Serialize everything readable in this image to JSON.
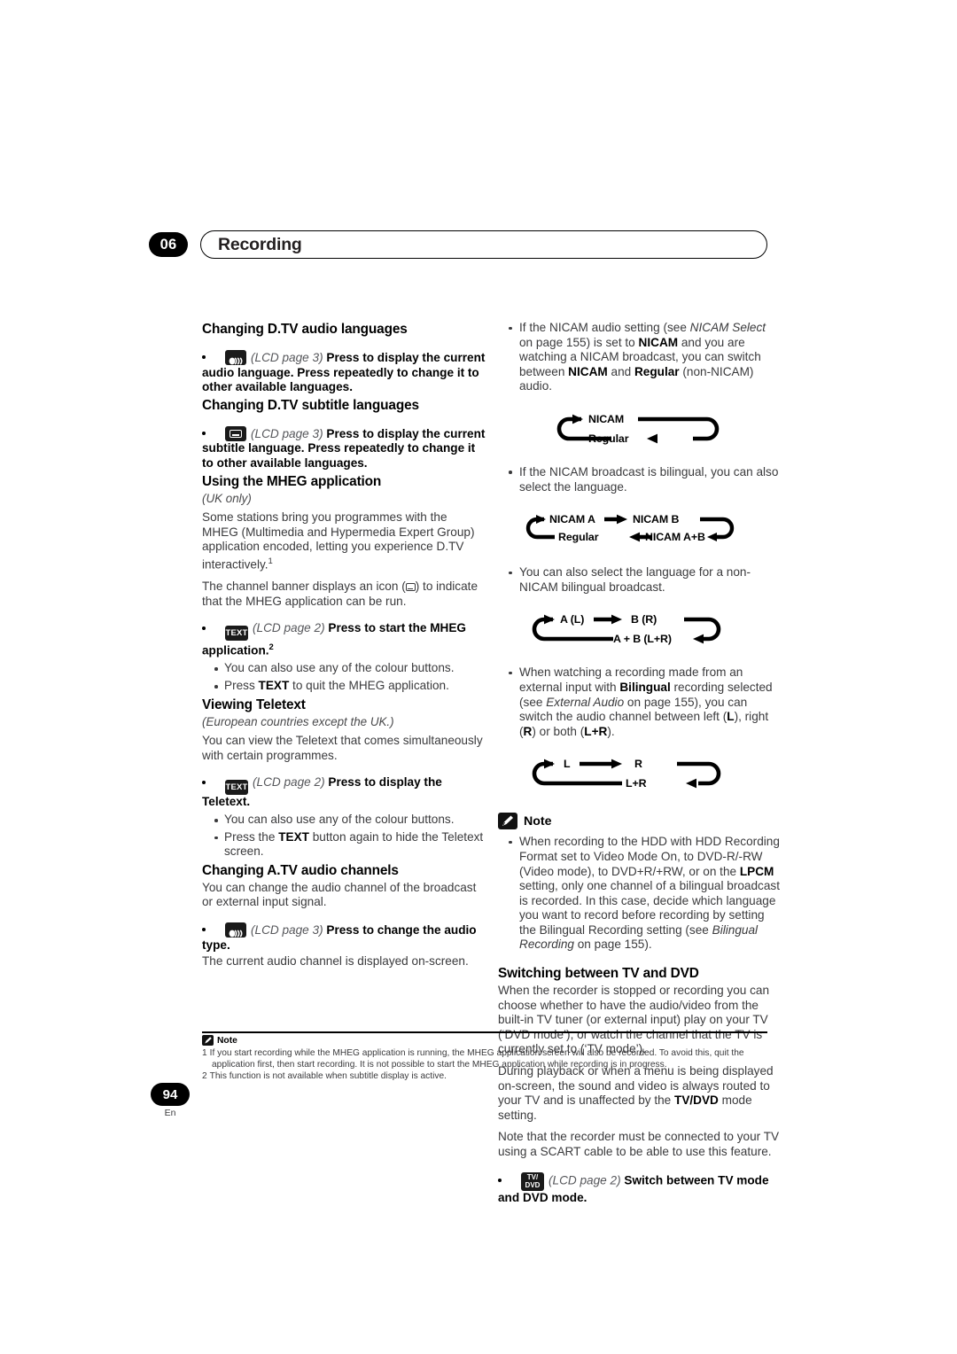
{
  "header": {
    "chapter_number": "06",
    "chapter_title": "Recording"
  },
  "left_column": {
    "s1": {
      "heading": "Changing D.TV audio languages",
      "key_icon": "audio-button-icon",
      "lcd": "(LCD page 3)",
      "instruction": "Press to display the current audio language. Press repeatedly to change it to other available languages."
    },
    "s2": {
      "heading": "Changing D.TV subtitle languages",
      "key_icon": "subtitle-button-icon",
      "lcd": "(LCD page 3)",
      "instruction": "Press to display the current subtitle language. Press repeatedly to change it to other available languages."
    },
    "s3": {
      "heading": "Using the MHEG application",
      "region": "(UK only)",
      "para1_a": "Some stations bring you programmes with the MHEG (Multimedia and Hypermedia Expert Group) application encoded, letting you experience D.TV interactively.",
      "para1_sup": "1",
      "para2_a": "The channel banner displays an icon (",
      "para2_b": ") to indicate that the MHEG application can be run.",
      "key_icon": "text-button-icon",
      "key_label": "TEXT",
      "lcd": "(LCD page 2)",
      "instruction": "Press to start the MHEG application.",
      "instruction_sup": "2",
      "sub_bullets": [
        "You can also use any of the colour buttons.",
        "Press TEXT to quit the MHEG application."
      ]
    },
    "s4": {
      "heading": "Viewing Teletext",
      "region": "(European countries except the UK.)",
      "para1": "You can view the Teletext that comes simultaneously with certain programmes.",
      "key_icon": "text-button-icon",
      "key_label": "TEXT",
      "lcd": "(LCD page 2)",
      "instruction": "Press to display the Teletext.",
      "sub_bullets": [
        "You can also use any of the colour buttons.",
        "Press the TEXT button again to hide the Teletext screen."
      ]
    },
    "s5": {
      "heading": "Changing A.TV audio channels",
      "para1": "You can change the audio channel of the broadcast or external input signal.",
      "key_icon": "audio-button-icon",
      "lcd": "(LCD page 3)",
      "instruction": "Press to change the audio type.",
      "para2": "The current audio channel is displayed on-screen."
    }
  },
  "right_column": {
    "bullets": [
      "If the NICAM audio setting (see NICAM Select on page 155) is set to NICAM and you are watching a NICAM broadcast, you can switch between NICAM and Regular (non-NICAM) audio.",
      "If the NICAM broadcast is bilingual, you can also select the language.",
      "You can also select the language for a non-NICAM bilingual broadcast.",
      "When watching a recording made from an external input with Bilingual recording selected (see External Audio on page 155), you can switch the audio channel between left (L), right (R) or both (L+R)."
    ],
    "diagrams": [
      {
        "name": "nicam-regular-cycle",
        "labels": [
          "NICAM",
          "Regular"
        ]
      },
      {
        "name": "nicam-bilingual-cycle",
        "labels": [
          "NICAM A",
          "NICAM B",
          "NICAM A+B",
          "Regular"
        ]
      },
      {
        "name": "non-nicam-bilingual-cycle",
        "labels": [
          "A (L)",
          "B (R)",
          "A + B (L+R)"
        ]
      },
      {
        "name": "external-lr-cycle",
        "labels": [
          "L",
          "R",
          "L+R"
        ]
      }
    ],
    "note": {
      "label": "Note",
      "text": "When recording to the HDD with HDD Recording Format set to Video Mode On, to DVD-R/-RW (Video mode), to DVD+R/+RW, or on the LPCM setting, only one channel of a bilingual broadcast is recorded. In this case, decide which language you want to record before recording by setting the Bilingual Recording setting (see Bilingual Recording on page 155)."
    },
    "s6": {
      "heading": "Switching between TV and DVD",
      "para1": "When the recorder is stopped or recording you can choose whether to have the audio/video from the built-in TV tuner (or external input) play on your TV (‘DVD mode’), or watch the channel that the TV is currently set to (‘TV mode’).",
      "para2": "During playback or when a menu is being displayed on-screen, the sound and video is always routed to your TV and is unaffected by the TV/DVD mode setting.",
      "para3": "Note that the recorder must be connected to your TV using a SCART cable to be able to use this feature.",
      "key_icon": "tv-dvd-button-icon",
      "key_label_line1": "TV/",
      "key_label_line2": "DVD",
      "lcd": "(LCD page 2)",
      "instruction": "Switch between TV mode and DVD mode."
    }
  },
  "footnotes": {
    "label": "Note",
    "items": [
      {
        "num": "1",
        "text": "If you start recording while the MHEG application is running, the MHEG application screen will also be recorded. To avoid this, quit the application first, then start recording. It is not possible to start the MHEG application while recording is in progress."
      },
      {
        "num": "2",
        "text": "This function is not available when subtitle display is active."
      }
    ]
  },
  "footer": {
    "page_number": "94",
    "language": "En"
  }
}
